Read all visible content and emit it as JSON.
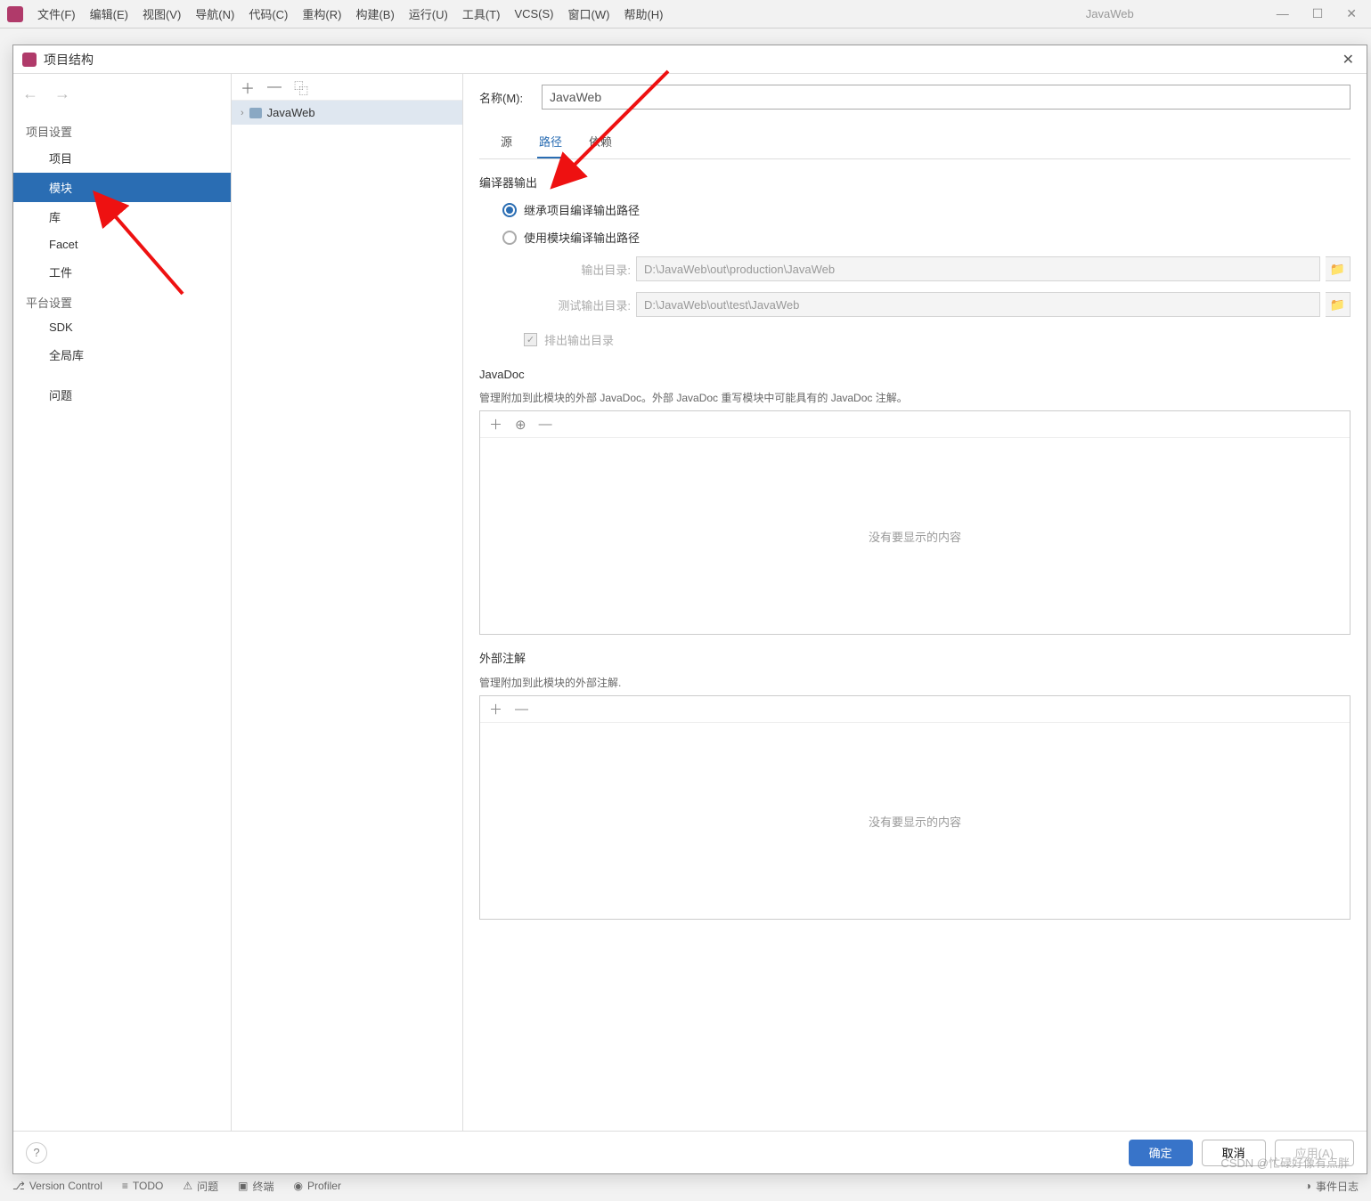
{
  "menubar": {
    "items": [
      "文件(F)",
      "编辑(E)",
      "视图(V)",
      "导航(N)",
      "代码(C)",
      "重构(R)",
      "构建(B)",
      "运行(U)",
      "工具(T)",
      "VCS(S)",
      "窗口(W)",
      "帮助(H)"
    ],
    "app_name": "JavaWeb"
  },
  "dialog": {
    "title": "项目结构",
    "leftnav": {
      "section1": "项目设置",
      "items1": [
        "项目",
        "模块",
        "库",
        "Facet",
        "工件"
      ],
      "section2": "平台设置",
      "items2": [
        "SDK",
        "全局库"
      ],
      "section3": "问题",
      "selected": "模块"
    },
    "tree": {
      "root": "JavaWeb"
    },
    "name_label": "名称(M):",
    "name_value": "JavaWeb",
    "tabs": [
      "源",
      "路径",
      "依赖"
    ],
    "active_tab": "路径",
    "compiler": {
      "heading": "编译器输出",
      "radio_inherit": "继承项目编译输出路径",
      "radio_module": "使用模块编译输出路径",
      "out_label": "输出目录:",
      "out_value": "D:\\JavaWeb\\out\\production\\JavaWeb",
      "test_label": "测试输出目录:",
      "test_value": "D:\\JavaWeb\\out\\test\\JavaWeb",
      "exclude": "排出输出目录"
    },
    "javadoc": {
      "heading": "JavaDoc",
      "desc": "管理附加到此模块的外部 JavaDoc。外部 JavaDoc 重写模块中可能具有的 JavaDoc 注解。",
      "empty": "没有要显示的内容"
    },
    "annotations": {
      "heading": "外部注解",
      "desc": "管理附加到此模块的外部注解.",
      "empty": "没有要显示的内容"
    },
    "footer": {
      "ok": "确定",
      "cancel": "取消",
      "apply": "应用(A)"
    }
  },
  "statusbar": {
    "vcs": "Version Control",
    "todo": "TODO",
    "problems": "问题",
    "terminal": "终端",
    "profiler": "Profiler",
    "events": "事件日志"
  },
  "watermark": "CSDN @忙碌好像有点胖"
}
